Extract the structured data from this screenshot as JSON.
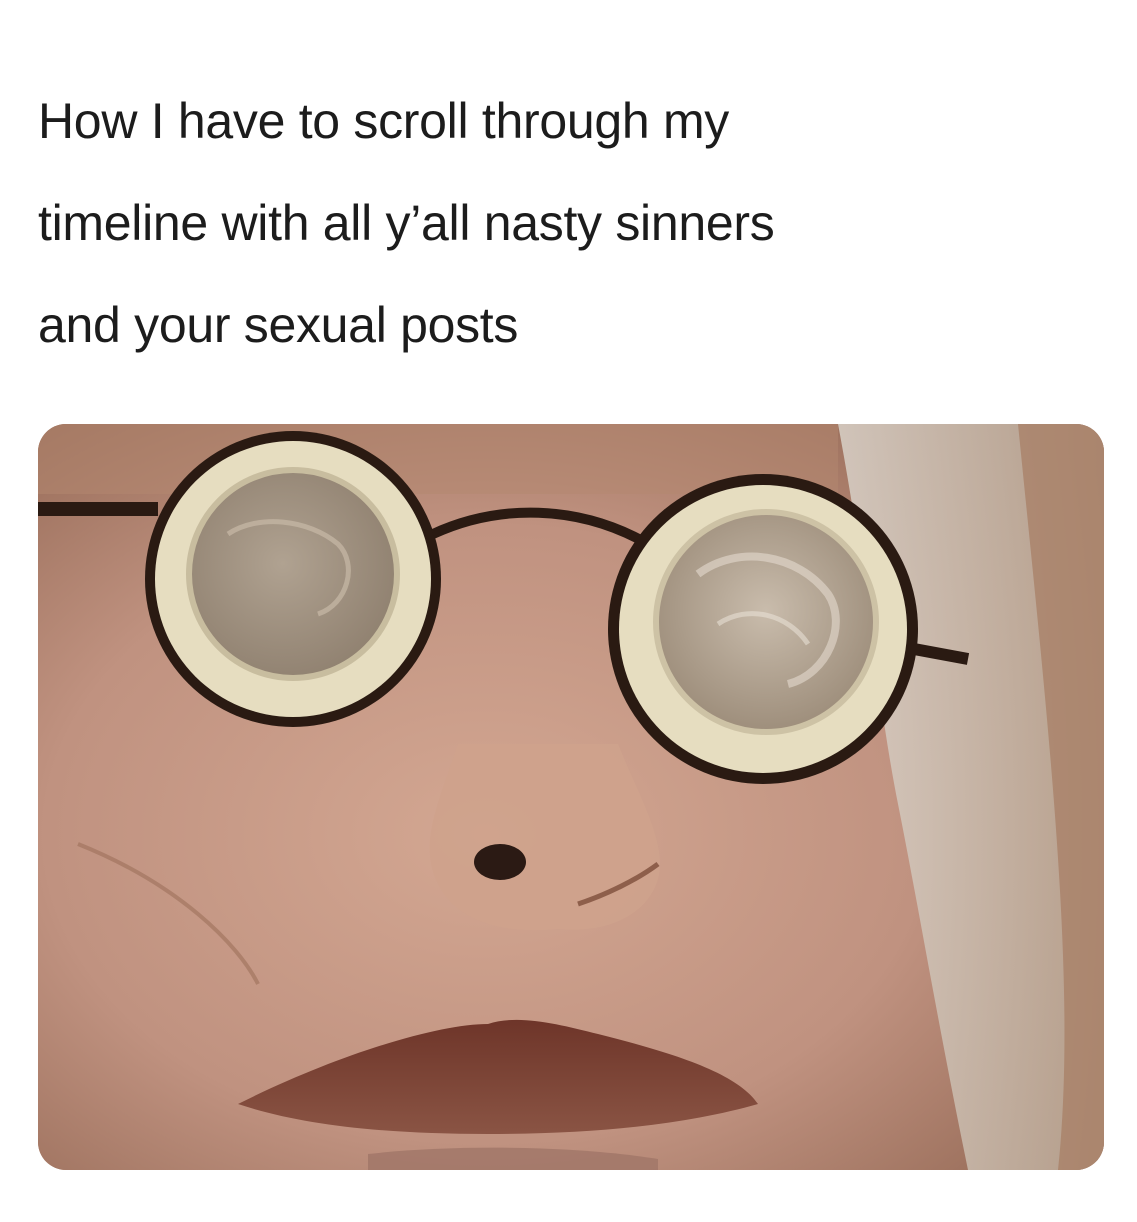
{
  "caption": {
    "lines": [
      "How I have to scroll through my",
      "timeline with all y’all nasty sinners",
      "and your sexual posts"
    ]
  },
  "photo": {
    "subject": "close-up face with round glasses covered by condoms",
    "colors": {
      "skin": "#c39782",
      "skin_shadow": "#9d6f5a",
      "hair": "#d8d0c6",
      "frame": "#2a1a12",
      "ring": "#e6ddc0",
      "lens": "#a99a88",
      "lips": "#7a3f33"
    }
  }
}
